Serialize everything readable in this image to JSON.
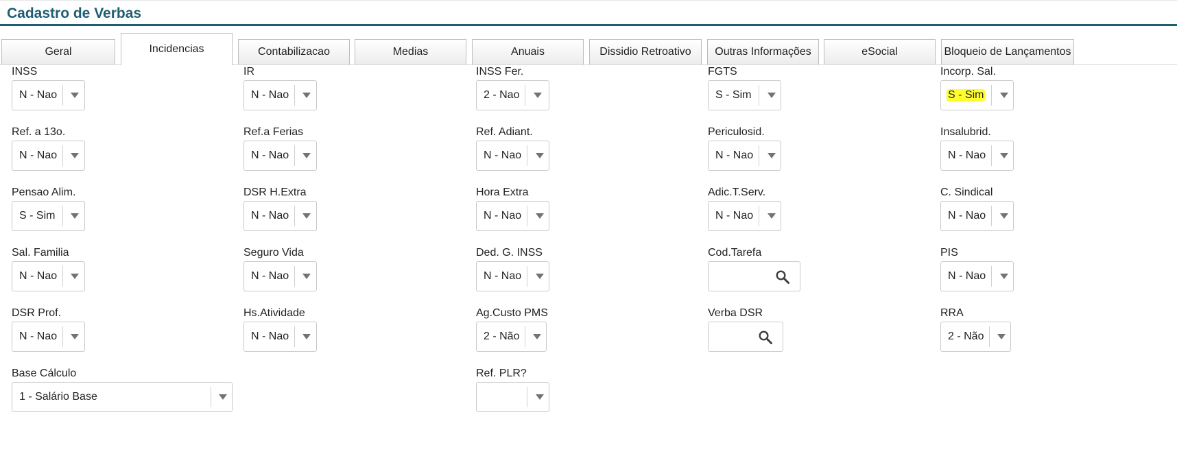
{
  "page": {
    "title": "Cadastro de Verbas"
  },
  "tabs": [
    {
      "label": "Geral"
    },
    {
      "label": "Incidencias",
      "active": true
    },
    {
      "label": "Contabilizacao"
    },
    {
      "label": "Medias"
    },
    {
      "label": "Anuais"
    },
    {
      "label": "Dissidio Retroativo"
    },
    {
      "label": "Outras Informações"
    },
    {
      "label": "eSocial"
    },
    {
      "label": "Bloqueio de Lançamentos"
    }
  ],
  "fields": {
    "inss": {
      "label": "INSS",
      "value": "N - Nao"
    },
    "ir": {
      "label": "IR",
      "value": "N - Nao"
    },
    "inss_fer": {
      "label": "INSS Fer.",
      "value": "2 - Nao"
    },
    "fgts": {
      "label": "FGTS",
      "value": "S - Sim"
    },
    "incorp_sal": {
      "label": "Incorp. Sal.",
      "value": "S - Sim",
      "highlight_color": "#ffff2e"
    },
    "ref_13o": {
      "label": "Ref. a 13o.",
      "value": "N - Nao"
    },
    "ref_ferias": {
      "label": "Ref.a Ferias",
      "value": "N - Nao"
    },
    "ref_adiant": {
      "label": "Ref. Adiant.",
      "value": "N - Nao"
    },
    "periculosid": {
      "label": "Periculosid.",
      "value": "N - Nao"
    },
    "insalubrid": {
      "label": "Insalubrid.",
      "value": "N - Nao"
    },
    "pensao_alim": {
      "label": "Pensao Alim.",
      "value": "S - Sim"
    },
    "dsr_hextra": {
      "label": "DSR H.Extra",
      "value": "N - Nao"
    },
    "hora_extra": {
      "label": "Hora Extra",
      "value": "N - Nao"
    },
    "adic_tserv": {
      "label": "Adic.T.Serv.",
      "value": "N - Nao"
    },
    "c_sindical": {
      "label": "C. Sindical",
      "value": "N - Nao"
    },
    "sal_familia": {
      "label": "Sal. Familia",
      "value": "N - Nao"
    },
    "seguro_vida": {
      "label": "Seguro Vida",
      "value": "N - Nao"
    },
    "ded_g_inss": {
      "label": "Ded. G. INSS",
      "value": "N - Nao"
    },
    "cod_tarefa": {
      "label": "Cod.Tarefa",
      "value": ""
    },
    "pis": {
      "label": "PIS",
      "value": "N - Nao"
    },
    "dsr_prof": {
      "label": "DSR Prof.",
      "value": "N - Nao"
    },
    "hs_atividade": {
      "label": "Hs.Atividade",
      "value": "N - Nao"
    },
    "ag_custo_pms": {
      "label": "Ag.Custo PMS",
      "value": "2 - Não"
    },
    "verba_dsr": {
      "label": "Verba DSR",
      "value": ""
    },
    "rra": {
      "label": "RRA",
      "value": "2 - Não"
    },
    "base_calculo": {
      "label": "Base Cálculo",
      "value": "1 - Salário Base"
    },
    "ref_plr": {
      "label": "Ref. PLR?",
      "value": ""
    }
  },
  "colors": {
    "title": "#1d5f72",
    "dropdown_arrow": "#6f7478"
  },
  "icons": {
    "dropdown": "chevron-down-icon",
    "lookup": "search-icon"
  }
}
